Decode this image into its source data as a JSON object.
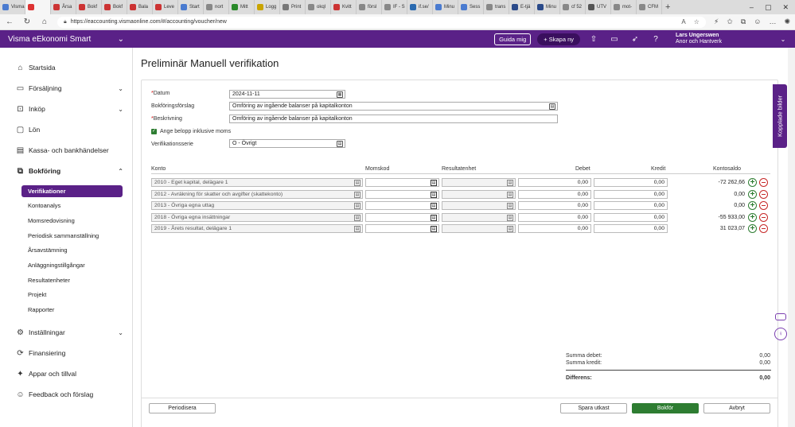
{
  "browser": {
    "tabs": [
      {
        "label": "Visma",
        "color": "#4a7bd0"
      },
      {
        "label": "",
        "color": "#d33",
        "active": true
      },
      {
        "label": "Årsa",
        "color": "#c33"
      },
      {
        "label": "Bokf",
        "color": "#c33"
      },
      {
        "label": "Bokf",
        "color": "#c33"
      },
      {
        "label": "Bala",
        "color": "#c33"
      },
      {
        "label": "Leve",
        "color": "#c33"
      },
      {
        "label": "Start",
        "color": "#4a7bd0"
      },
      {
        "label": "nort",
        "color": "#888"
      },
      {
        "label": "Mitt",
        "color": "#2a8a2a"
      },
      {
        "label": "Logg",
        "color": "#c9a400"
      },
      {
        "label": "Print",
        "color": "#777"
      },
      {
        "label": "okql",
        "color": "#888"
      },
      {
        "label": "Kvitt",
        "color": "#c33"
      },
      {
        "label": "försl",
        "color": "#888"
      },
      {
        "label": "IF - S",
        "color": "#888"
      },
      {
        "label": "if.se/",
        "color": "#2a6ab0"
      },
      {
        "label": "Minu",
        "color": "#4a7bd0"
      },
      {
        "label": "Sess",
        "color": "#4a7bd0"
      },
      {
        "label": "trans",
        "color": "#888"
      },
      {
        "label": "E-tjä",
        "color": "#2a4a8a"
      },
      {
        "label": "Minu",
        "color": "#2a4a8a"
      },
      {
        "label": "cf 52",
        "color": "#888"
      },
      {
        "label": "UTV",
        "color": "#555"
      },
      {
        "label": "mot-",
        "color": "#888"
      },
      {
        "label": "CFM",
        "color": "#888"
      }
    ],
    "url": "https://eaccounting.vismaonline.com/#/accounting/voucher/new"
  },
  "header": {
    "brand": "Visma eEkonomi Smart",
    "guida": "Guida mig",
    "skapa": "+ Skapa ny",
    "user_name": "Lars Ungerswen",
    "company": "Anor och Hantverk"
  },
  "sidebar": {
    "items": [
      {
        "label": "Startsida",
        "icon": "home-icon",
        "glyph": "⌂"
      },
      {
        "label": "Försäljning",
        "icon": "sales-icon",
        "glyph": "▭"
      },
      {
        "label": "Inköp",
        "icon": "purchase-icon",
        "glyph": "⊡"
      },
      {
        "label": "Lön",
        "icon": "salary-icon",
        "glyph": "▢"
      },
      {
        "label": "Kassa- och bankhändelser",
        "icon": "bank-icon",
        "glyph": "▤"
      },
      {
        "label": "Bokföring",
        "icon": "bookkeeping-icon",
        "glyph": "⧉"
      }
    ],
    "subitems": [
      "Verifikationer",
      "Kontoanalys",
      "Momsredovisning",
      "Periodisk sammanställning",
      "Årsavstämning",
      "Anläggningstillgångar",
      "Resultatenheter",
      "Projekt",
      "Rapporter"
    ],
    "bottom_items": [
      {
        "label": "Inställningar",
        "icon": "settings-icon",
        "glyph": "⚙"
      },
      {
        "label": "Finansiering",
        "icon": "finance-icon",
        "glyph": "⟳"
      },
      {
        "label": "Appar och tillval",
        "icon": "apps-icon",
        "glyph": "✦"
      },
      {
        "label": "Feedback och förslag",
        "icon": "feedback-icon",
        "glyph": "☺"
      }
    ]
  },
  "page": {
    "title": "Preliminär Manuell verifikation",
    "datum_label": "Datum",
    "datum_value": "2024-11-11",
    "forslag_label": "Bokföringsförslag",
    "forslag_value": "Omföring av ingående balanser på kapitalkonton",
    "beskrivning_label": "Beskrivning",
    "beskrivning_value": "Omföring av ingående balanser på kapitalkonton",
    "moms_check_label": "Ange belopp inklusive moms",
    "serie_label": "Verifikationsserie",
    "serie_value": "O - Övrigt"
  },
  "table": {
    "headers": {
      "konto": "Konto",
      "momskod": "Momskod",
      "resultatenhet": "Resultatenhet",
      "debet": "Debet",
      "kredit": "Kredit",
      "kontosaldo": "Kontosaldo"
    },
    "rows": [
      {
        "konto": "2010 - Eget kapital, delägare 1",
        "debet": "0,00",
        "kredit": "0,00",
        "saldo": "-72 262,66"
      },
      {
        "konto": "2012 - Avräkning för skatter och avgifter (skattekonto)",
        "debet": "0,00",
        "kredit": "0,00",
        "saldo": "0,00"
      },
      {
        "konto": "2013 - Övriga egna uttag",
        "debet": "0,00",
        "kredit": "0,00",
        "saldo": "0,00"
      },
      {
        "konto": "2018 - Övriga egna insättningar",
        "debet": "0,00",
        "kredit": "0,00",
        "saldo": "-55 933,00"
      },
      {
        "konto": "2019 - Årets resultat, delägare 1",
        "debet": "0,00",
        "kredit": "0,00",
        "saldo": "31 023,07"
      }
    ]
  },
  "summary": {
    "debet_label": "Summa debet:",
    "debet_value": "0,00",
    "kredit_label": "Summa kredit:",
    "kredit_value": "0,00",
    "diff_label": "Differens:",
    "diff_value": "0,00"
  },
  "footer": {
    "periodisera": "Periodisera",
    "spara": "Spara utkast",
    "bokfor": "Bokför",
    "avbryt": "Avbryt"
  },
  "side_tab": "Kopplade bilder",
  "colors": {
    "brand": "#5a2187",
    "primary_button": "#2e7d32",
    "remove": "#c62828"
  }
}
